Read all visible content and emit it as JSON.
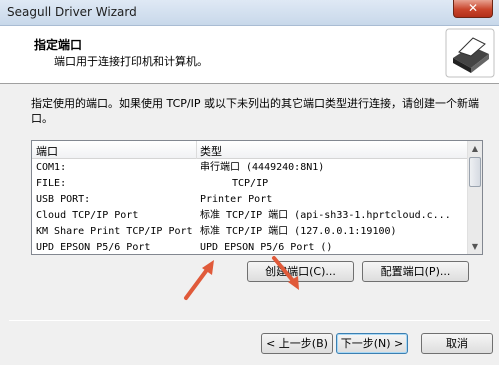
{
  "window": {
    "title": "Seagull Driver Wizard",
    "close_label": "✕"
  },
  "header": {
    "title": "指定端口",
    "subtitle": "端口用于连接打印机和计算机。"
  },
  "description": "指定使用的端口。如果使用 TCP/IP 或以下未列出的其它端口类型进行连接，请创建一个新端口。",
  "ports": {
    "columns": [
      "端口",
      "类型"
    ],
    "rows": [
      {
        "port": "COM1:",
        "type": "串行端口 (4449240:8N1)"
      },
      {
        "port": "FILE:",
        "type": "TCP/IP"
      },
      {
        "port": "USB PORT:",
        "type": "Printer Port"
      },
      {
        "port": "Cloud TCP/IP Port",
        "type": "标准 TCP/IP 端口 (api-sh33-1.hprtcloud.c..."
      },
      {
        "port": "KM Share Print TCP/IP Port",
        "type": "标准 TCP/IP 端口 (127.0.0.1:19100)"
      },
      {
        "port": "UPD EPSON P5/6 Port",
        "type": "UPD EPSON P5/6 Port ()"
      }
    ]
  },
  "buttons": {
    "create_port": "创建端口(C)...",
    "configure_port": "配置端口(P)...",
    "back": "< 上一步(B)",
    "next": "下一步(N) >",
    "cancel": "取消"
  },
  "colors": {
    "annotation_arrow": "#e05a3a"
  }
}
